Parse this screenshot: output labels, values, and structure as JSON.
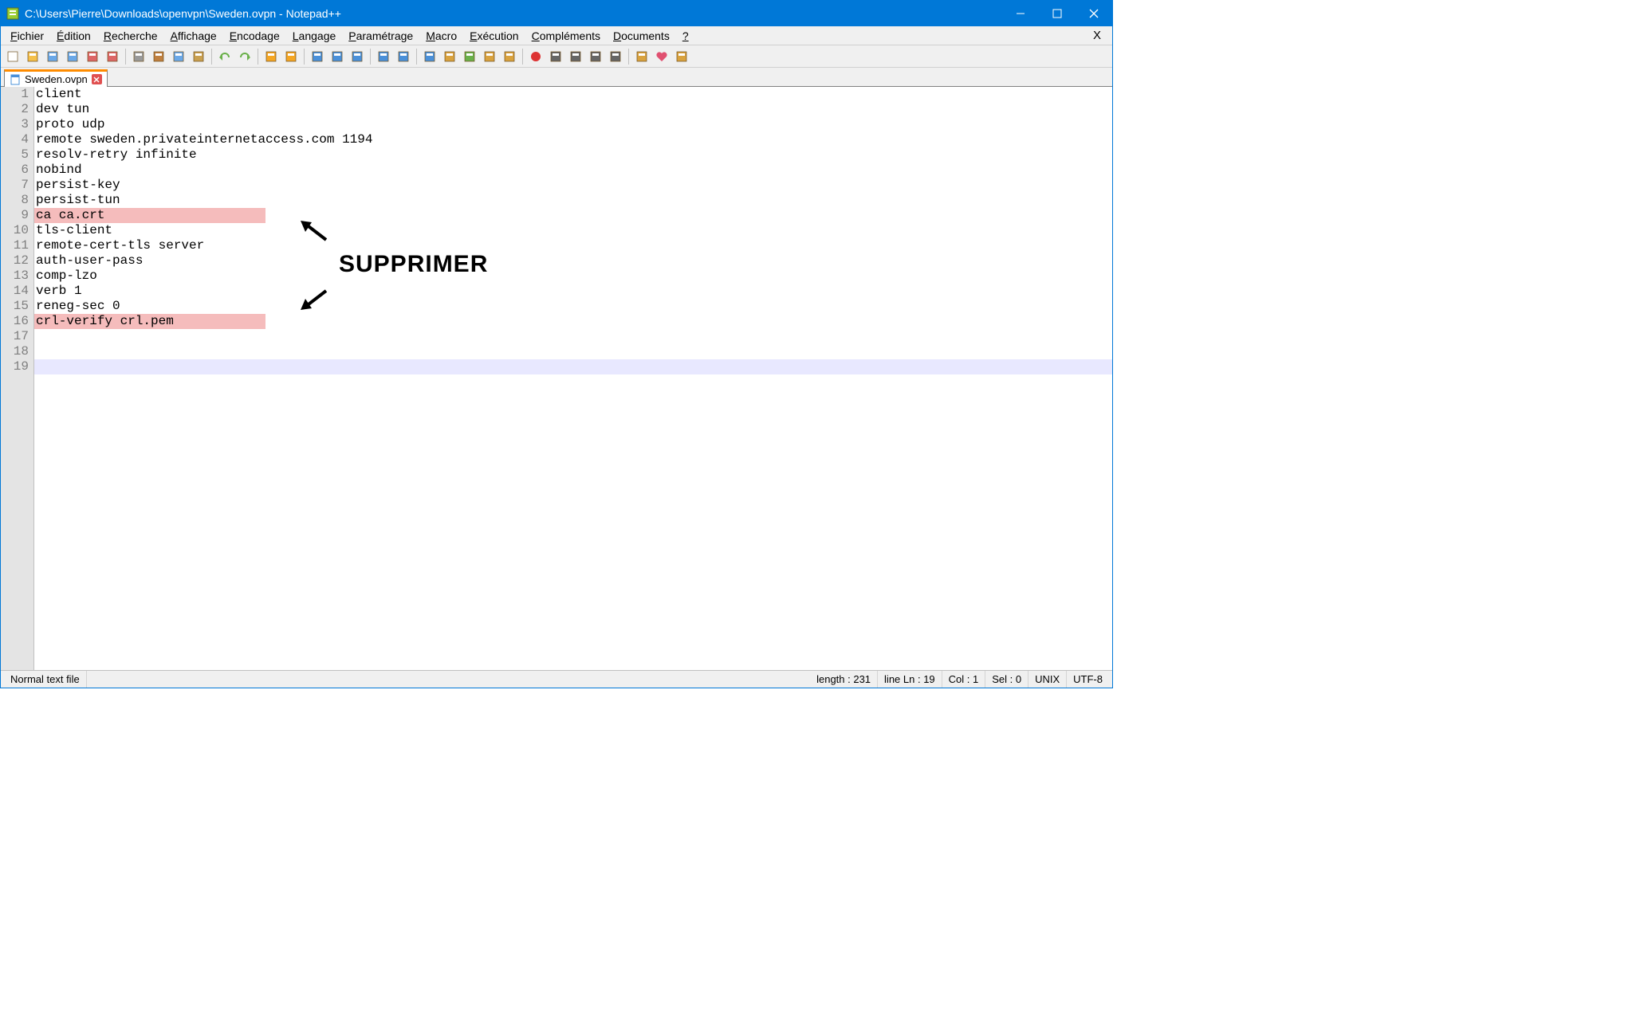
{
  "window": {
    "title": "C:\\Users\\Pierre\\Downloads\\openvpn\\Sweden.ovpn - Notepad++"
  },
  "menu": {
    "items": [
      "Fichier",
      "Édition",
      "Recherche",
      "Affichage",
      "Encodage",
      "Langage",
      "Paramétrage",
      "Macro",
      "Exécution",
      "Compléments",
      "Documents",
      "?"
    ],
    "close": "X"
  },
  "tab": {
    "label": "Sweden.ovpn"
  },
  "editor": {
    "lines": [
      {
        "n": 1,
        "t": "client",
        "hl": false
      },
      {
        "n": 2,
        "t": "dev tun",
        "hl": false
      },
      {
        "n": 3,
        "t": "proto udp",
        "hl": false
      },
      {
        "n": 4,
        "t": "remote sweden.privateinternetaccess.com 1194",
        "hl": false
      },
      {
        "n": 5,
        "t": "resolv-retry infinite",
        "hl": false
      },
      {
        "n": 6,
        "t": "nobind",
        "hl": false
      },
      {
        "n": 7,
        "t": "persist-key",
        "hl": false
      },
      {
        "n": 8,
        "t": "persist-tun",
        "hl": false
      },
      {
        "n": 9,
        "t": "ca ca.crt",
        "hl": true
      },
      {
        "n": 10,
        "t": "tls-client",
        "hl": false
      },
      {
        "n": 11,
        "t": "remote-cert-tls server",
        "hl": false
      },
      {
        "n": 12,
        "t": "auth-user-pass",
        "hl": false
      },
      {
        "n": 13,
        "t": "comp-lzo",
        "hl": false
      },
      {
        "n": 14,
        "t": "verb 1",
        "hl": false
      },
      {
        "n": 15,
        "t": "reneg-sec 0",
        "hl": false
      },
      {
        "n": 16,
        "t": "crl-verify crl.pem",
        "hl": true
      },
      {
        "n": 17,
        "t": "",
        "hl": false
      },
      {
        "n": 18,
        "t": "",
        "hl": false
      },
      {
        "n": 19,
        "t": "",
        "hl": false,
        "cursor": true
      }
    ]
  },
  "annotation": {
    "label": "SUPPRIMER"
  },
  "status": {
    "filetype": "Normal text file",
    "length": "length : 231",
    "line": "line Ln : 19",
    "col": "Col : 1",
    "sel": "Sel : 0",
    "eol": "UNIX",
    "enc": "UTF-8"
  },
  "icons": {
    "toolbar": [
      "new",
      "open",
      "save",
      "save-all",
      "close",
      "close-all",
      "print",
      "cut",
      "copy",
      "paste",
      "undo",
      "redo",
      "find",
      "replace",
      "zoom-in",
      "zoom-out",
      "sync",
      "wrap",
      "all-chars",
      "indent",
      "lang",
      "doc-map",
      "func-list",
      "folder",
      "record",
      "stop",
      "play",
      "play-fast",
      "run",
      "spell",
      "heart",
      "donate"
    ]
  }
}
